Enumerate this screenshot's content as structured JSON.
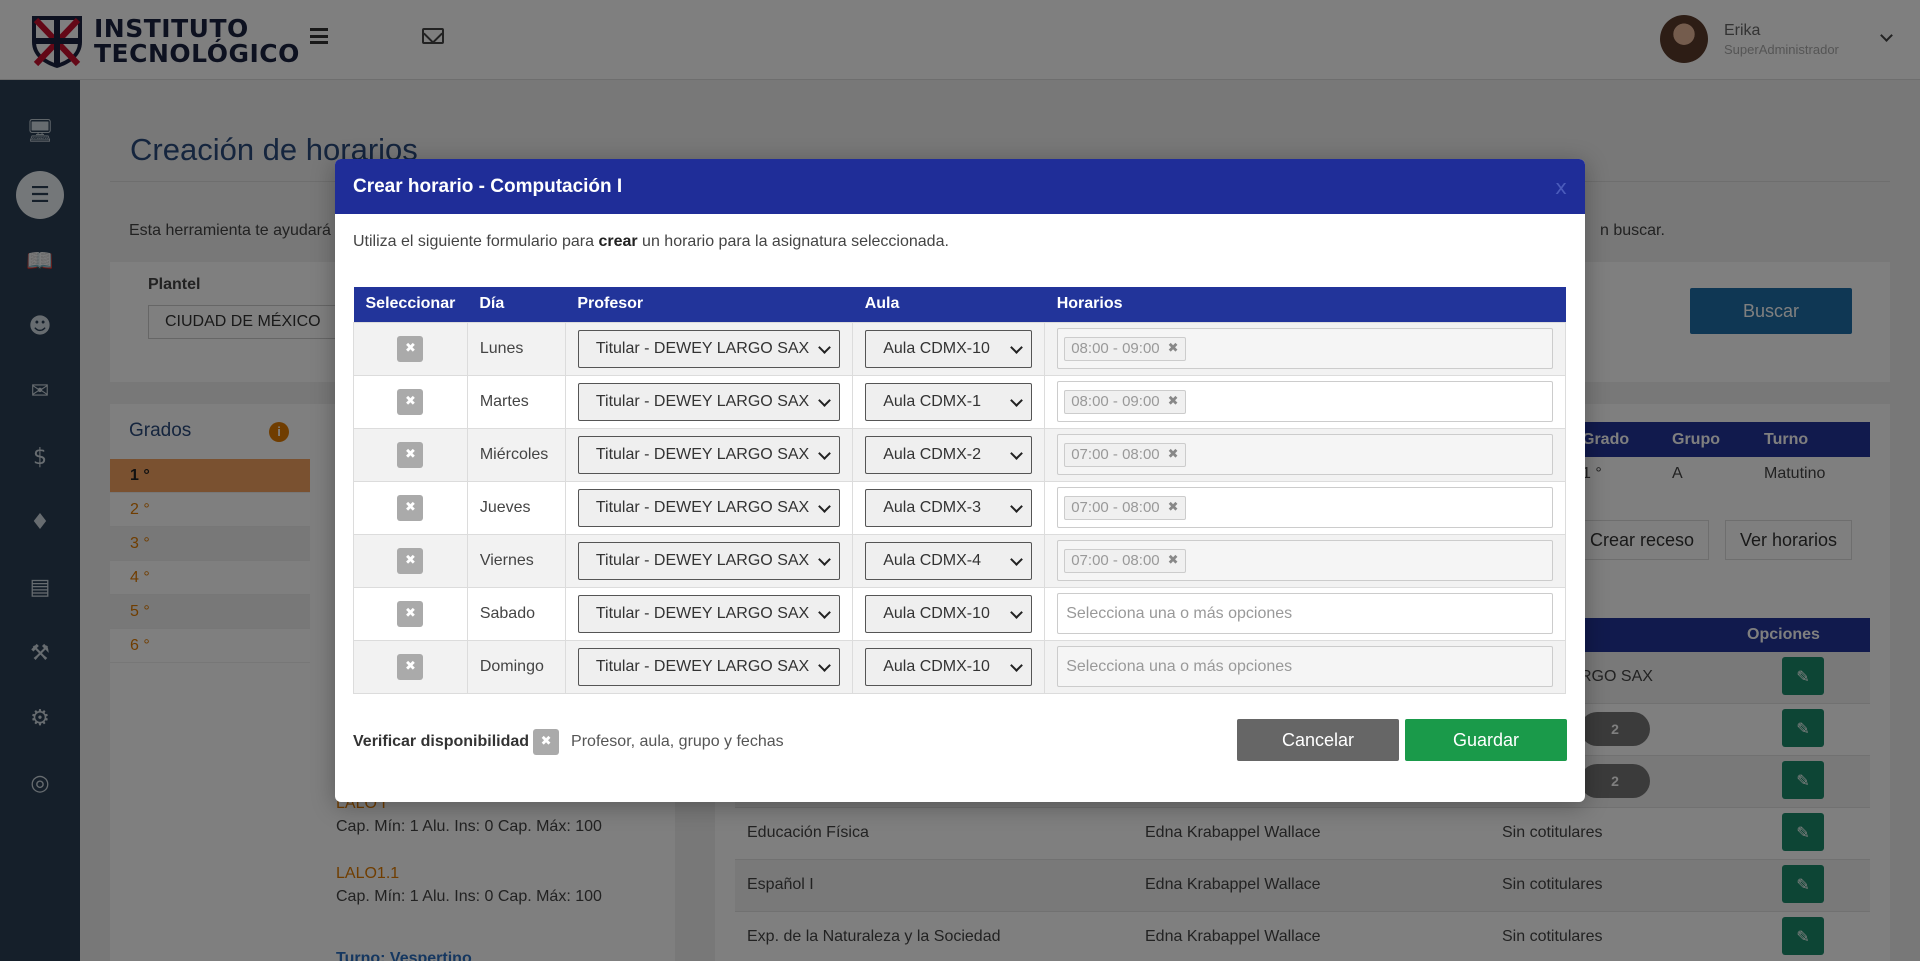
{
  "header": {
    "logo_line1": "INSTITUTO",
    "logo_line2": "TECNOLÓGICO",
    "user_name": "Erika",
    "user_role": "SuperAdministrador"
  },
  "sidebar": {
    "icons": [
      "monitor-icon",
      "book-icon",
      "open-book-icon",
      "users-icon",
      "chat-icon",
      "dollar-icon",
      "puzzle-icon",
      "chart-icon",
      "wrench-icon",
      "settings-icon",
      "globe-icon"
    ],
    "active_index": 1
  },
  "background": {
    "page_title": "Creación de horarios",
    "intro_left": "Esta herramienta te ayudará",
    "intro_right": "n buscar.",
    "plantel_label": "Plantel",
    "plantel_value": "CIUDAD DE MÉXICO",
    "buscar_label": "Buscar",
    "grados_title": "Grados",
    "grados_info": "i",
    "grades": [
      "1 °",
      "2 °",
      "3 °",
      "4 °",
      "5 °",
      "6 °"
    ],
    "group_name_1": "LALO I",
    "group_name_2": "LALO1.1",
    "cap_text": "Cap. Mín: 1 Alu. Ins: 0 Cap. Máx: 100",
    "turno_vespertino": "Turno: Vespertino",
    "summary_headers": [
      "Grado",
      "Grupo",
      "Turno"
    ],
    "summary_values": [
      "1 °",
      "A",
      "Matutino"
    ],
    "crear_receso": "Crear receso",
    "ver_horarios": "Ver horarios",
    "opciones_header": "Opciones",
    "partial_text": "RGO SAX",
    "pill_value": "2",
    "subjects": [
      {
        "name": "Educación Física",
        "teacher": "Edna Krabappel Wallace",
        "cotit": "Sin cotitulares"
      },
      {
        "name": "Español I",
        "teacher": "Edna Krabappel Wallace",
        "cotit": "Sin cotitulares"
      },
      {
        "name": "Exp. de la Naturaleza y la Sociedad",
        "teacher": "Edna Krabappel Wallace",
        "cotit": "Sin cotitulares"
      }
    ]
  },
  "modal": {
    "title": "Crear horario - Computación I",
    "close": "x",
    "desc_before": "Utiliza el siguiente formulario para ",
    "desc_bold": "crear",
    "desc_after": " un horario para la asignatura seleccionada.",
    "columns": [
      "Seleccionar",
      "Día",
      "Profesor",
      "Aula",
      "Horarios"
    ],
    "placeholder": "Selecciona una o más opciones",
    "rows": [
      {
        "day": "Lunes",
        "teacher": "Titular - DEWEY LARGO SAX",
        "room": "Aula CDMX-10",
        "slot": "08:00 - 09:00"
      },
      {
        "day": "Martes",
        "teacher": "Titular - DEWEY LARGO SAX",
        "room": "Aula CDMX-1",
        "slot": "08:00 - 09:00"
      },
      {
        "day": "Miércoles",
        "teacher": "Titular - DEWEY LARGO SAX",
        "room": "Aula CDMX-2",
        "slot": "07:00 - 08:00"
      },
      {
        "day": "Jueves",
        "teacher": "Titular - DEWEY LARGO SAX",
        "room": "Aula CDMX-3",
        "slot": "07:00 - 08:00"
      },
      {
        "day": "Viernes",
        "teacher": "Titular - DEWEY LARGO SAX",
        "room": "Aula CDMX-4",
        "slot": "07:00 - 08:00"
      },
      {
        "day": "Sabado",
        "teacher": "Titular - DEWEY LARGO SAX",
        "room": "Aula CDMX-10",
        "slot": ""
      },
      {
        "day": "Domingo",
        "teacher": "Titular - DEWEY LARGO SAX",
        "room": "Aula CDMX-10",
        "slot": ""
      }
    ],
    "verify_label": "Verificar disponibilidad",
    "verify_text": "Profesor, aula, grupo y fechas",
    "cancel_label": "Cancelar",
    "save_label": "Guardar"
  },
  "colors": {
    "modal_header": "#1f2d98",
    "table_header": "#22349a",
    "save": "#1a9a4a",
    "cancel": "#666666",
    "accent_orange": "#e07b00"
  }
}
